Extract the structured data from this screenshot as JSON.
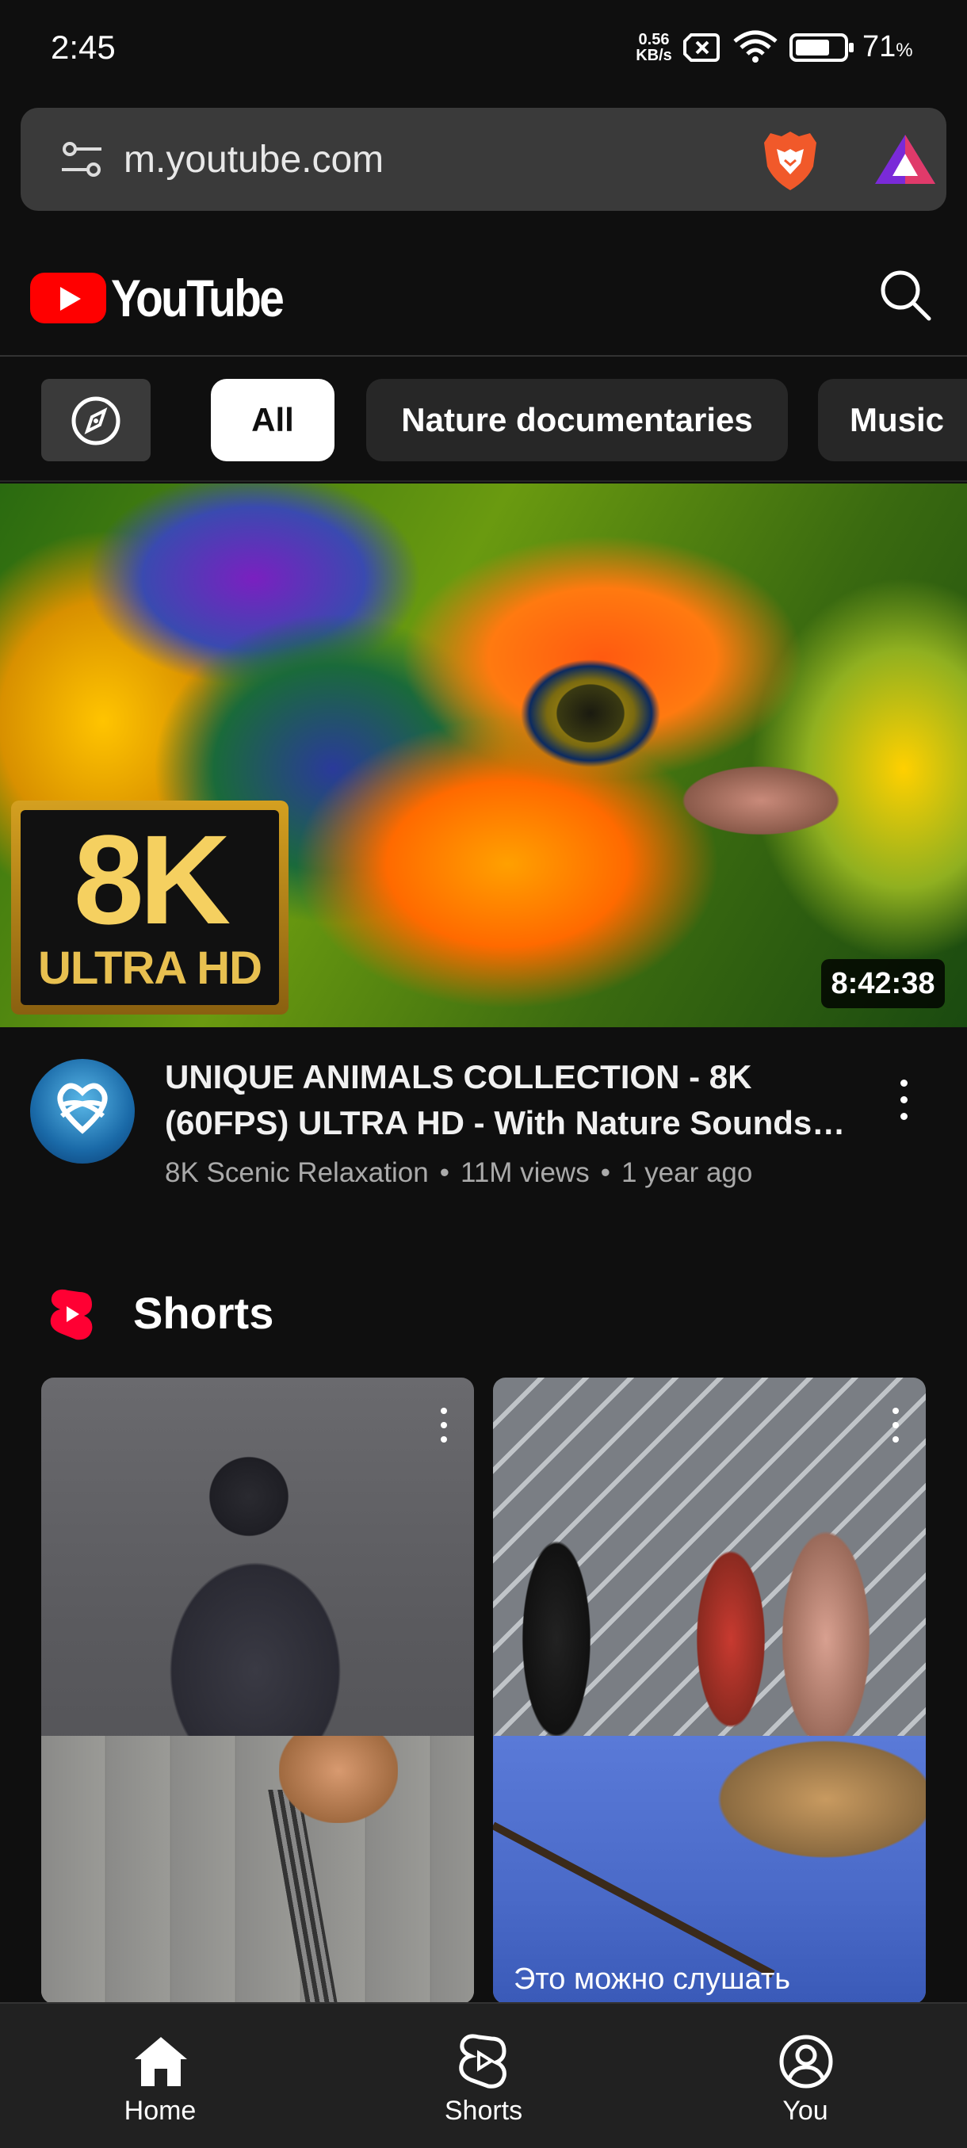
{
  "status_bar": {
    "time": "2:45",
    "speed_value": "0.56",
    "speed_unit": "KB/s",
    "battery_percent": "71",
    "battery_symbol": "%"
  },
  "browser": {
    "url": "m.youtube.com"
  },
  "header": {
    "logo_text": "YouTube"
  },
  "chips": [
    "All",
    "Nature documentaries",
    "Music"
  ],
  "featured_video": {
    "badge_big": "8K",
    "badge_small": "ULTRA HD",
    "duration": "8:42:38",
    "title": "UNIQUE ANIMALS COLLECTION - 8K (60FPS) ULTRA HD - With Nature Sounds (Colorfully Dynamic)",
    "channel": "8K Scenic Relaxation",
    "views": "11M views",
    "age": "1 year ago"
  },
  "shorts": {
    "heading": "Shorts",
    "items": [
      {
        "caption": ""
      },
      {
        "caption": "Это можно слушать"
      }
    ]
  },
  "bottom_nav": {
    "items": [
      {
        "label": "Home",
        "icon": "home-icon"
      },
      {
        "label": "Shorts",
        "icon": "shorts-icon"
      },
      {
        "label": "You",
        "icon": "account-icon"
      }
    ]
  },
  "colors": {
    "background": "#0f0f0f",
    "brand_red": "#ff0000",
    "chip_bg": "#272727",
    "chip_active_bg": "#ffffff",
    "secondary_text": "#aaaaaa"
  }
}
